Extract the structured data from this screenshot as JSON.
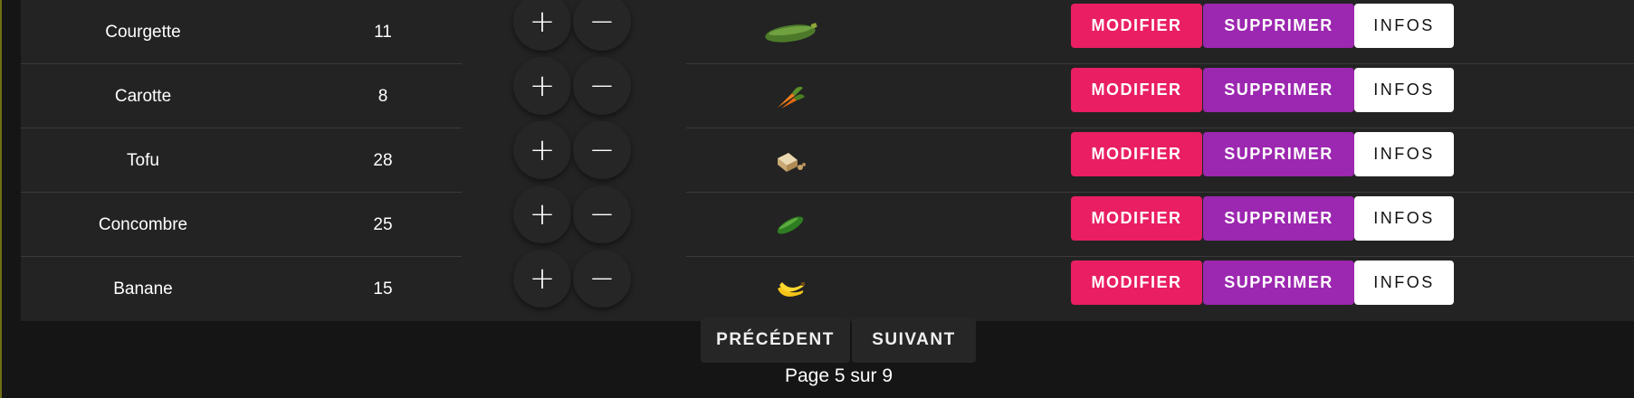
{
  "colors": {
    "modify": "#e91e63",
    "delete": "#9c27b0",
    "info": "#ffffff",
    "background": "#151515",
    "row": "#232323"
  },
  "actions": {
    "plus_symbol": "+",
    "minus_symbol": "−",
    "modify_label": "MODIFIER",
    "delete_label": "SUPPRIMER",
    "info_label": "INFOS"
  },
  "rows": [
    {
      "name": "Courgette",
      "qty": "11",
      "icon": "zucchini-icon"
    },
    {
      "name": "Carotte",
      "qty": "8",
      "icon": "carrot-icon"
    },
    {
      "name": "Tofu",
      "qty": "28",
      "icon": "tofu-icon"
    },
    {
      "name": "Concombre",
      "qty": "25",
      "icon": "cucumber-icon"
    },
    {
      "name": "Banane",
      "qty": "15",
      "icon": "banana-icon"
    }
  ],
  "pagination": {
    "prev_label": "PRÉCÉDENT",
    "next_label": "SUIVANT",
    "page_text": "Page 5 sur 9"
  }
}
